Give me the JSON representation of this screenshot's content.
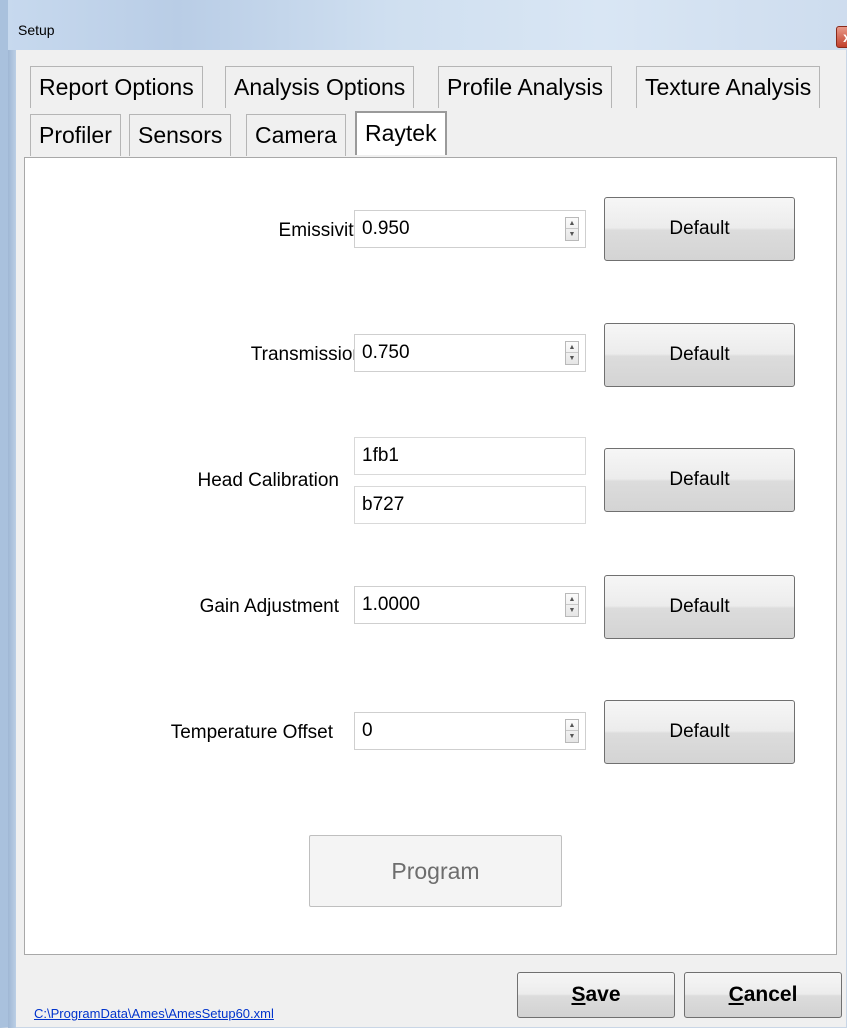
{
  "window": {
    "title": "Setup",
    "close_glyph": "x"
  },
  "tabs_row1": [
    {
      "label": "Report Options"
    },
    {
      "label": "Analysis Options"
    },
    {
      "label": "Profile Analysis"
    },
    {
      "label": "Texture Analysis"
    }
  ],
  "tabs_row2": [
    {
      "label": "Profiler"
    },
    {
      "label": "Sensors"
    },
    {
      "label": "Camera"
    },
    {
      "label": "Raytek",
      "selected": true
    }
  ],
  "fields": {
    "emissivity": {
      "label": "Emissivity",
      "value": "0.950"
    },
    "transmission": {
      "label": "Transmission",
      "value": "0.750"
    },
    "head_calibration": {
      "label": "Head Calibration",
      "value1": "1fb1",
      "value2": "b727"
    },
    "gain_adjustment": {
      "label": "Gain Adjustment",
      "value": "1.0000"
    },
    "temperature_offset": {
      "label": "Temperature Offset",
      "value": "0"
    }
  },
  "default_button_label": "Default",
  "program_button": {
    "label": "Program",
    "enabled": false
  },
  "footer": {
    "config_path": "C:\\ProgramData\\Ames\\AmesSetup60.xml",
    "save": {
      "mnemonic": "S",
      "rest": "ave"
    },
    "cancel": {
      "mnemonic": "C",
      "rest": "ancel"
    }
  },
  "icons": {
    "spin_up": "▲",
    "spin_down": "▼"
  },
  "colors": {
    "title_bar": "#c7d9ee",
    "link": "#0033cc",
    "close_button": "#c2402b"
  }
}
